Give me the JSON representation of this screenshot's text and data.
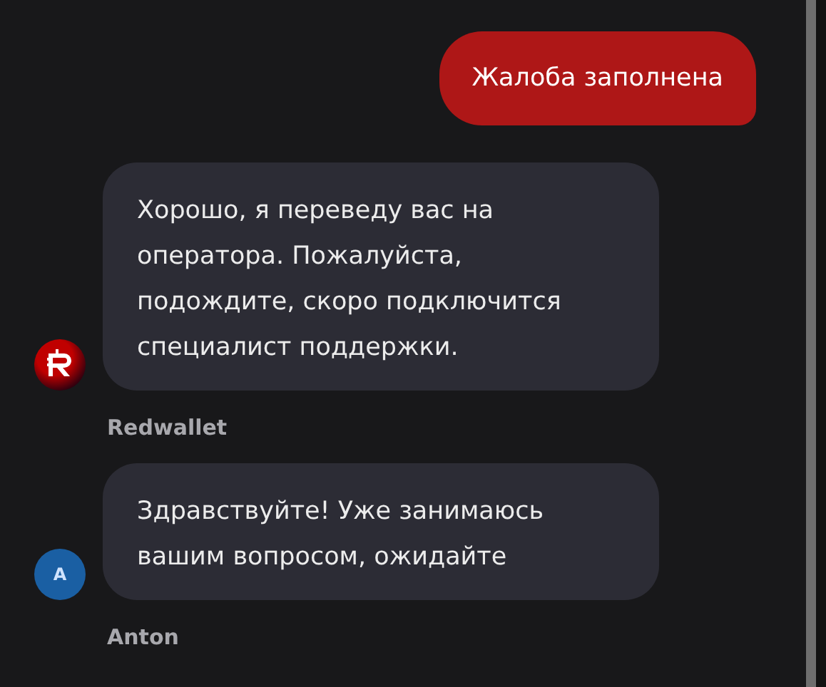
{
  "messages": [
    {
      "kind": "outgoing",
      "text": "Жалоба заполнена"
    },
    {
      "kind": "incoming",
      "avatar": {
        "kind": "logo"
      },
      "text": "Хорошо, я переведу вас на оператора. Пожалуйста, подождите, скоро подключится специалист поддержки.",
      "sender": "Redwallet"
    },
    {
      "kind": "incoming",
      "avatar": {
        "kind": "initial",
        "initial": "A"
      },
      "text": "Здравствуйте! Уже занимаюсь вашим вопросом, ожидайте",
      "sender": "Anton"
    }
  ]
}
